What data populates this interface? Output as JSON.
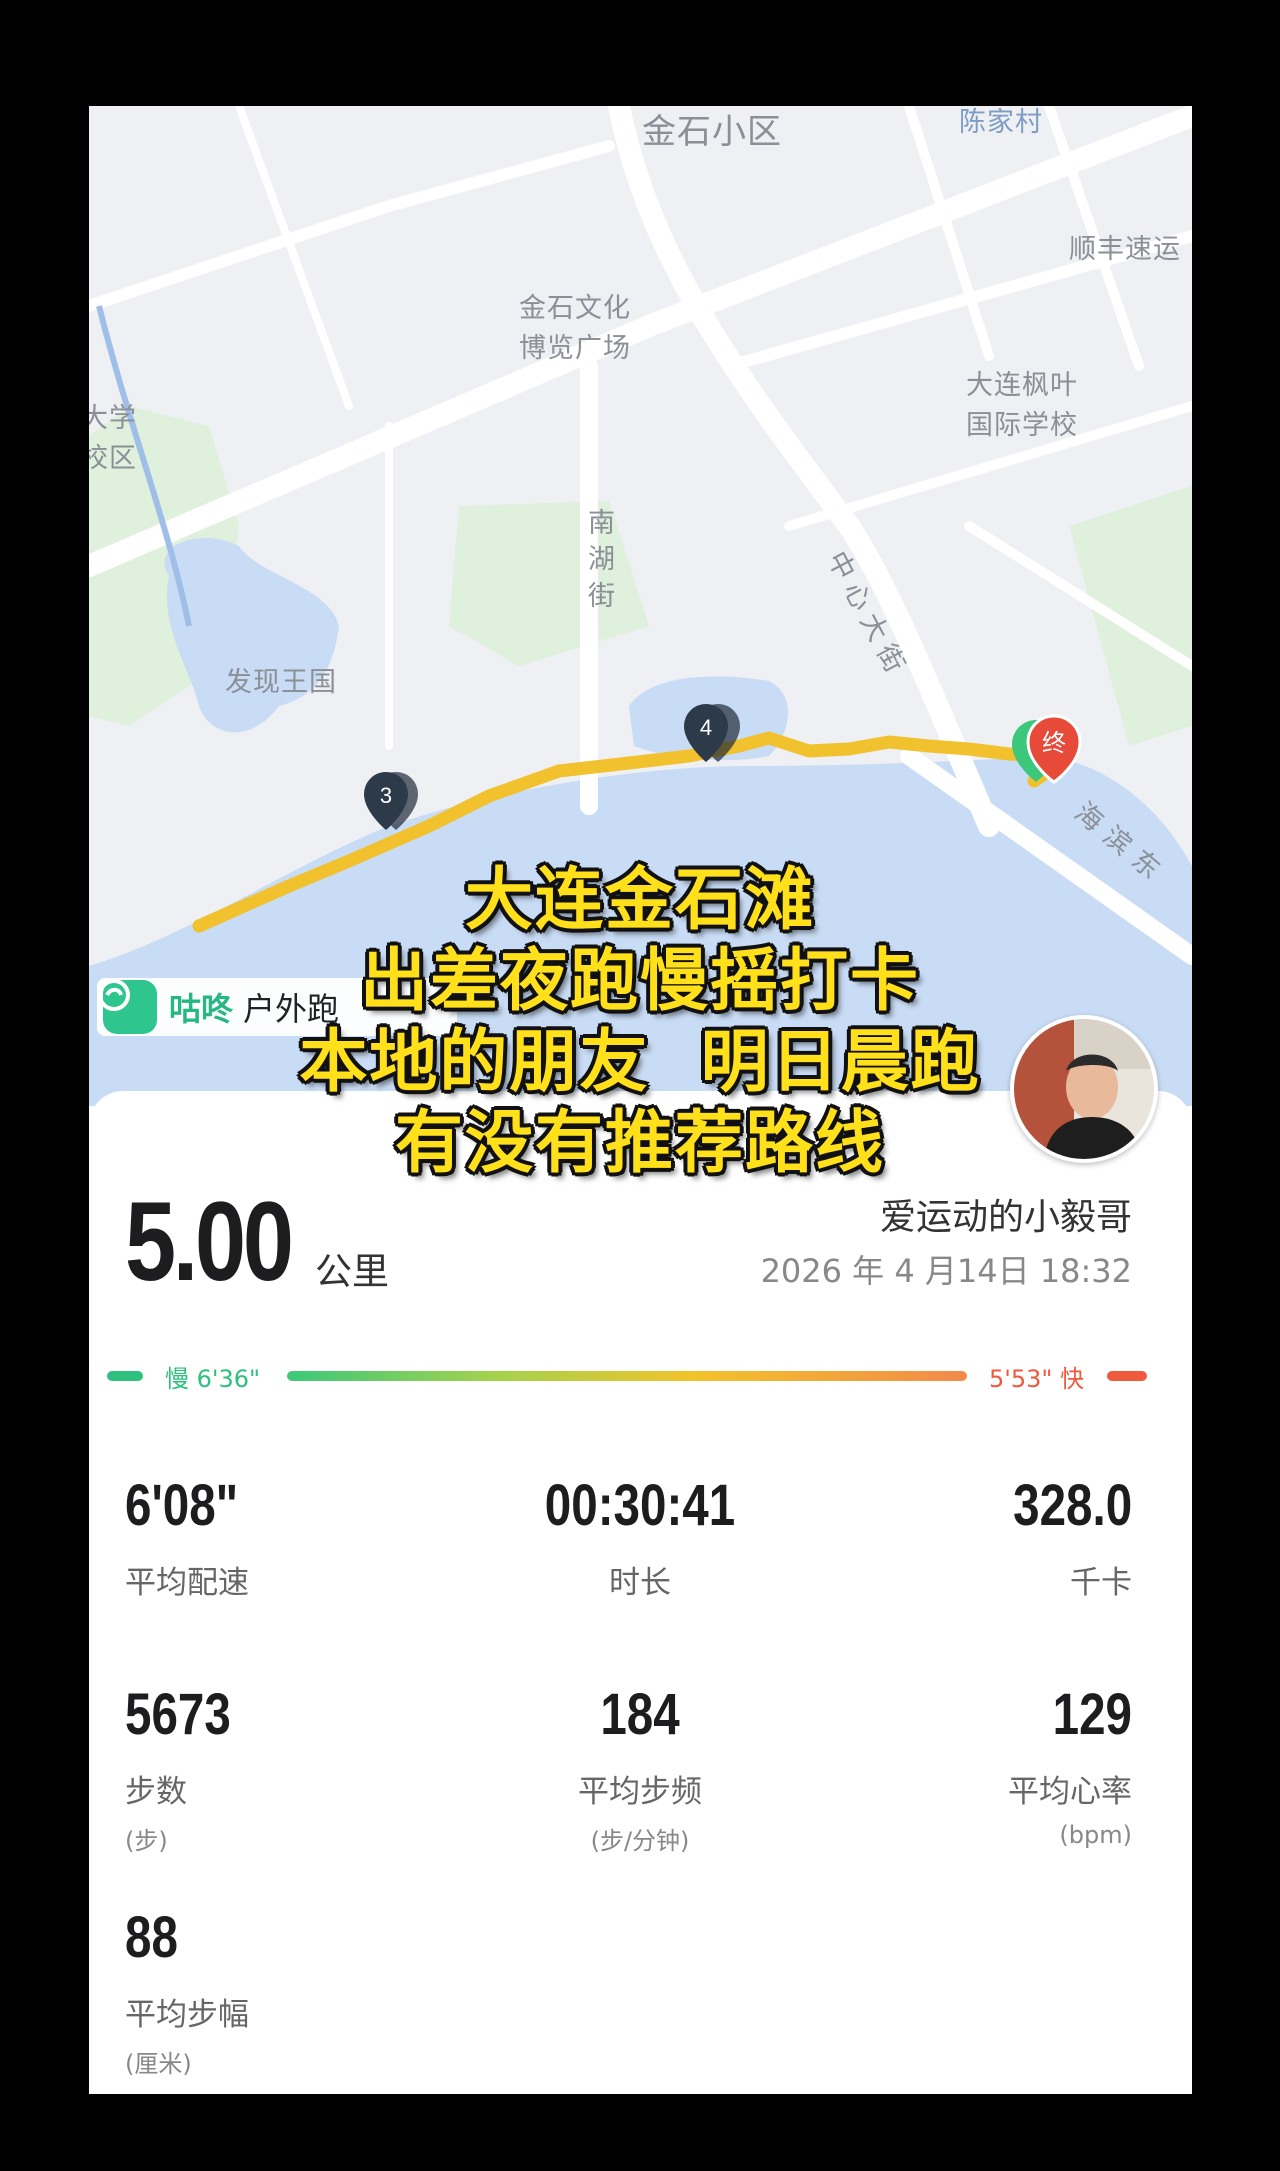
{
  "map": {
    "labels": {
      "jinshi_xiaoqu": "金石小区",
      "chenjiacun": "陈家村",
      "shunfeng": "顺丰速运",
      "jinshi_culture_1": "金石文化",
      "jinshi_culture_2": "博览广场",
      "maple_1": "大连枫叶",
      "maple_2": "国际学校",
      "school_1": "大学",
      "school_2": "校区",
      "nanhu": "南湖街",
      "zhongxin": "中心大街",
      "discovery": "发现王国",
      "haibin": "海滨东"
    },
    "markers": [
      {
        "label": "3",
        "color": "#2d3a4a"
      },
      {
        "label": "4",
        "color": "#2d3a4a"
      },
      {
        "label": "终",
        "color": "#e84a3a"
      }
    ],
    "route_color": "#f2c12e",
    "water_color": "#c9dcf5",
    "park_color": "#dff0dc"
  },
  "brand": {
    "name": "咕咚",
    "sub": "户外跑"
  },
  "overlay": {
    "lines": [
      "大连金石滩",
      "出差夜跑慢摇打卡",
      "本地的朋友  明日晨跑",
      "有没有推荐路线"
    ]
  },
  "summary": {
    "distance": "5.00",
    "distance_unit": "公里",
    "username": "爱运动的小毅哥",
    "datetime": "2026 年 4 月14日 18:32"
  },
  "pace_scale": {
    "slow_label": "慢 6'36\"",
    "fast_label": "5'53\" 快",
    "slow_color": "#2ec07d",
    "fast_color": "#ef5a3c"
  },
  "stats": {
    "avg_pace": {
      "value": "6'08\"",
      "label": "平均配速"
    },
    "duration": {
      "value": "00:30:41",
      "label": "时长"
    },
    "calories": {
      "value": "328.0",
      "label": "千卡"
    },
    "steps": {
      "value": "5673",
      "label": "步数",
      "unit": "(步)"
    },
    "cadence": {
      "value": "184",
      "label": "平均步频",
      "unit": "(步/分钟)"
    },
    "heart_rate": {
      "value": "129",
      "label": "平均心率",
      "unit": "(bpm)"
    },
    "stride": {
      "value": "88",
      "label": "平均步幅",
      "unit": "(厘米)"
    }
  }
}
